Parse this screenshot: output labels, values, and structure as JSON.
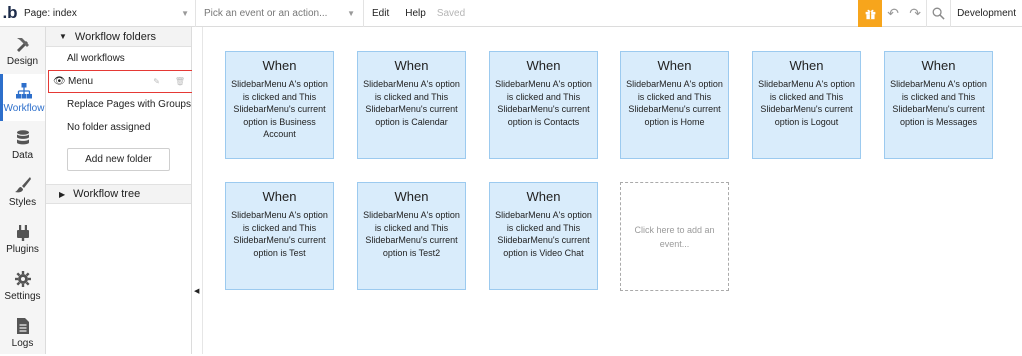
{
  "topbar": {
    "logo": ".b",
    "page_label": "Page: index",
    "event_placeholder": "Pick an event or an action...",
    "menu_edit": "Edit",
    "menu_help": "Help",
    "saved": "Saved",
    "mode": "Development",
    "icons": [
      "gift-icon",
      "undo-icon",
      "redo-icon",
      "search-icon"
    ],
    "accent": "#f7a51c"
  },
  "nav": [
    {
      "label": "Design",
      "icon": "design-icon"
    },
    {
      "label": "Workflow",
      "icon": "workflow-icon"
    },
    {
      "label": "Data",
      "icon": "data-icon"
    },
    {
      "label": "Styles",
      "icon": "styles-icon"
    },
    {
      "label": "Plugins",
      "icon": "plugins-icon"
    },
    {
      "label": "Settings",
      "icon": "settings-icon"
    },
    {
      "label": "Logs",
      "icon": "logs-icon"
    }
  ],
  "panel": {
    "folders_title": "Workflow folders",
    "folders": [
      "All workflows",
      "Menu",
      "Replace Pages with Groups",
      "No folder assigned"
    ],
    "add_folder": "Add new folder",
    "tree_title": "Workflow tree"
  },
  "cards": [
    {
      "when": "When",
      "text": "SlidebarMenu A's option is clicked and This SlidebarMenu's current option is Business Account"
    },
    {
      "when": "When",
      "text": "SlidebarMenu A's option is clicked and This SlidebarMenu's current option is Calendar"
    },
    {
      "when": "When",
      "text": "SlidebarMenu A's option is clicked and This SlidebarMenu's current option is Contacts"
    },
    {
      "when": "When",
      "text": "SlidebarMenu A's option is clicked and This SlidebarMenu's current option is Home"
    },
    {
      "when": "When",
      "text": "SlidebarMenu A's option is clicked and This SlidebarMenu's current option is Logout"
    },
    {
      "when": "When",
      "text": "SlidebarMenu A's option is clicked and This SlidebarMenu's current option is Messages"
    },
    {
      "when": "When",
      "text": "SlidebarMenu A's option is clicked and This SlidebarMenu's current option is Test"
    },
    {
      "when": "When",
      "text": "SlidebarMenu A's option is clicked and This SlidebarMenu's current option is Test2"
    },
    {
      "when": "When",
      "text": "SlidebarMenu A's option is clicked and This SlidebarMenu's current option is Video Chat"
    }
  ],
  "add_event": "Click here to add an event..."
}
